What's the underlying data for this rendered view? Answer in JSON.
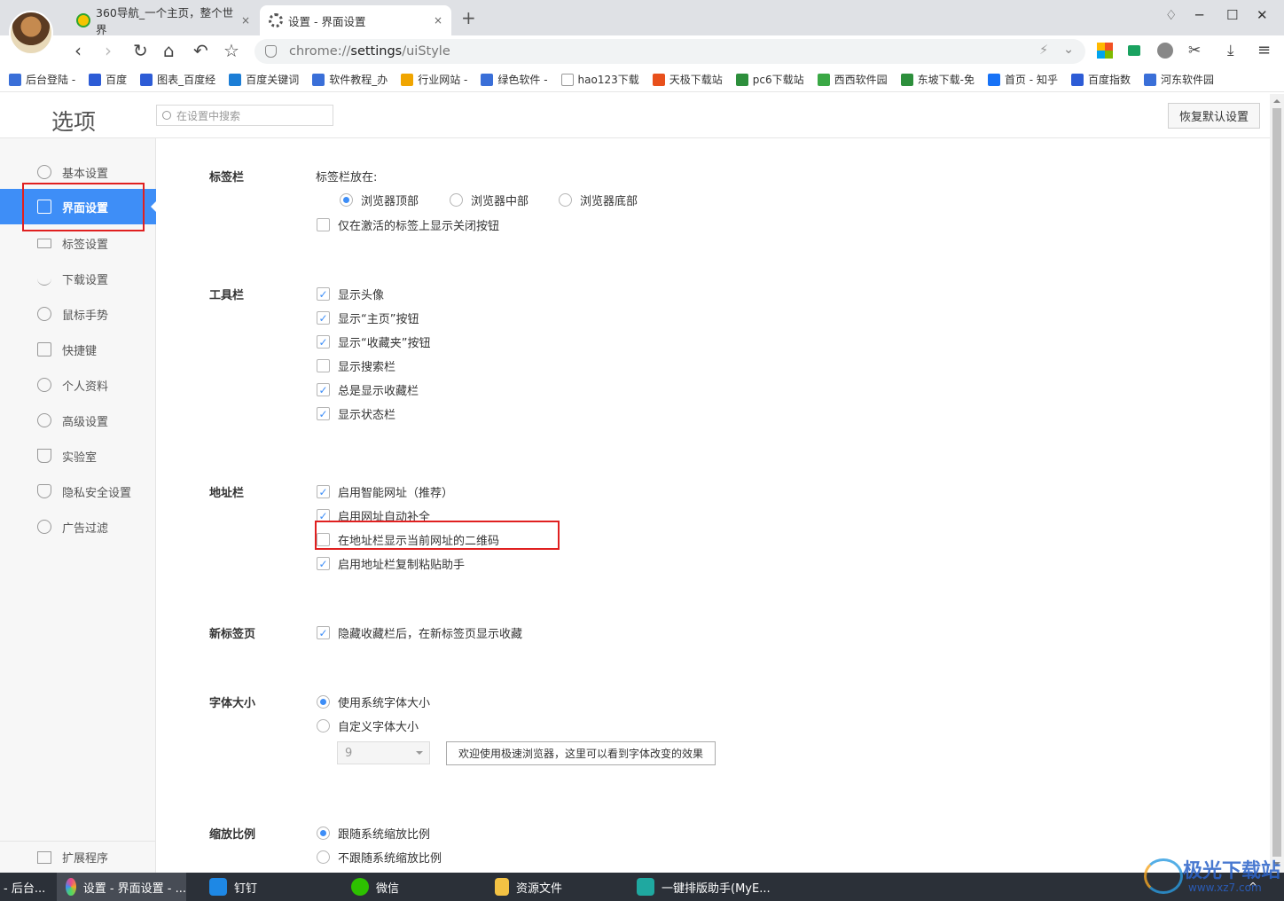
{
  "browser": {
    "tabs": [
      {
        "title": "360导航_一个主页，整个世界",
        "close": "×"
      },
      {
        "title": "设置 - 界面设置",
        "close": "×"
      }
    ],
    "new_tab": "+",
    "url_prefix": "chrome://",
    "url_host": "settings",
    "url_path": "/uiStyle",
    "window_controls": {
      "minimize": "─",
      "maximize": "☐",
      "close": "✕",
      "skin": "♢"
    }
  },
  "bookmarks": [
    {
      "label": "后台登陆 -",
      "color": "#3a6fd8"
    },
    {
      "label": "百度",
      "color": "#2d5cd6"
    },
    {
      "label": "图表_百度经",
      "color": "#2d5cd6"
    },
    {
      "label": "百度关键词",
      "color": "#1c7ed6"
    },
    {
      "label": "软件教程_办",
      "color": "#3a6fd8"
    },
    {
      "label": "行业网站 -",
      "color": "#f0a500"
    },
    {
      "label": "绿色软件 -",
      "color": "#3a6fd8"
    },
    {
      "label": "hao123下载",
      "color": "#ffffff"
    },
    {
      "label": "天极下载站",
      "color": "#e8501c"
    },
    {
      "label": "pc6下载站",
      "color": "#2d8f3c"
    },
    {
      "label": "西西软件园",
      "color": "#3aa845"
    },
    {
      "label": "东坡下载-免",
      "color": "#2d8f3c"
    },
    {
      "label": "首页 - 知乎",
      "color": "#1772f6"
    },
    {
      "label": "百度指数",
      "color": "#2d5cd6"
    },
    {
      "label": "河东软件园",
      "color": "#3a6fd8"
    }
  ],
  "header": {
    "title": "选项",
    "search_placeholder": "在设置中搜索",
    "reset_button": "恢复默认设置"
  },
  "sidebar": {
    "items": [
      {
        "label": "基本设置",
        "active": false
      },
      {
        "label": "界面设置",
        "active": true
      },
      {
        "label": "标签设置",
        "active": false
      },
      {
        "label": "下载设置",
        "active": false
      },
      {
        "label": "鼠标手势",
        "active": false
      },
      {
        "label": "快捷键",
        "active": false
      },
      {
        "label": "个人资料",
        "active": false
      },
      {
        "label": "高级设置",
        "active": false
      },
      {
        "label": "实验室",
        "active": false
      },
      {
        "label": "隐私安全设置",
        "active": false
      },
      {
        "label": "广告过滤",
        "active": false
      }
    ],
    "extensions": "扩展程序"
  },
  "sections": {
    "tabbar": {
      "title": "标签栏",
      "position_label": "标签栏放在:",
      "positions": [
        "浏览器顶部",
        "浏览器中部",
        "浏览器底部"
      ],
      "selected_position": "浏览器顶部",
      "close_on_active": {
        "label": "仅在激活的标签上显示关闭按钮",
        "checked": false
      }
    },
    "toolbar": {
      "title": "工具栏",
      "options": [
        {
          "label": "显示头像",
          "checked": true
        },
        {
          "label": "显示“主页”按钮",
          "checked": true
        },
        {
          "label": "显示“收藏夹”按钮",
          "checked": true
        },
        {
          "label": "显示搜索栏",
          "checked": false
        },
        {
          "label": "总是显示收藏栏",
          "checked": true
        },
        {
          "label": "显示状态栏",
          "checked": true
        }
      ]
    },
    "addressbar": {
      "title": "地址栏",
      "options": [
        {
          "label": "启用智能网址（推荐）",
          "checked": true
        },
        {
          "label": "启用网址自动补全",
          "checked": true
        },
        {
          "label": "在地址栏显示当前网址的二维码",
          "checked": false
        },
        {
          "label": "启用地址栏复制粘贴助手",
          "checked": true
        }
      ]
    },
    "newtab": {
      "title": "新标签页",
      "option": {
        "label": "隐藏收藏栏后，在新标签页显示收藏",
        "checked": true
      }
    },
    "fontsize": {
      "title": "字体大小",
      "options": [
        {
          "label": "使用系统字体大小",
          "selected": true
        },
        {
          "label": "自定义字体大小",
          "selected": false
        }
      ],
      "size_value": "9",
      "preview_text": "欢迎使用极速浏览器，这里可以看到字体改变的效果"
    },
    "zoom": {
      "title": "缩放比例",
      "options": [
        {
          "label": "跟随系统缩放比例",
          "selected": true
        },
        {
          "label": "不跟随系统缩放比例",
          "selected": false
        }
      ]
    }
  },
  "taskbar": {
    "items": [
      {
        "label": "- 后台...",
        "color": "#3a6fd8"
      },
      {
        "label": "设置 - 界面设置 - ...",
        "color": "#e84a8c"
      },
      {
        "label": "钉钉",
        "color": "#1e88e5"
      },
      {
        "label": "微信",
        "color": "#2dc100"
      },
      {
        "label": "资源文件",
        "color": "#f3c244"
      },
      {
        "label": "一键排版助手(MyE...",
        "color": "#1fa8a0"
      }
    ],
    "tray_arrow": "^"
  },
  "watermark": {
    "text": "极光下载站",
    "url": "www.xz7.com"
  },
  "colors": {
    "accent": "#3e8ef7",
    "highlight_box": "#e02020"
  }
}
